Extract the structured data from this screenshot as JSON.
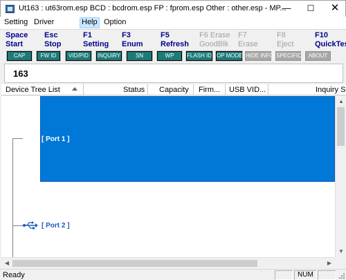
{
  "window": {
    "title": "Ut163 : ut63rom.esp BCD : bcdrom.esp FP : fprom.esp Other : other.esp - MP...",
    "minimize": "—",
    "maximize": "☐",
    "close": "✕"
  },
  "menu": {
    "setting": "Setting",
    "driver": "Driver",
    "help": "Help",
    "option": "Option"
  },
  "function_keys": [
    {
      "key": "Space",
      "label": "Start",
      "enabled": true
    },
    {
      "key": "Esc",
      "label": "Stop",
      "enabled": true
    },
    {
      "key": "F1",
      "label": "Setting",
      "enabled": true
    },
    {
      "key": "F3",
      "label": "Enum",
      "enabled": true
    },
    {
      "key": "F5",
      "label": "Refresh",
      "enabled": true
    },
    {
      "key": "F6 Erase",
      "label": "GoodBlk",
      "enabled": false
    },
    {
      "key": "F7",
      "label": "Erase",
      "enabled": false
    },
    {
      "key": "F8",
      "label": "Eject",
      "enabled": false
    },
    {
      "key": "F10",
      "label": "QuickTest",
      "enabled": true
    }
  ],
  "mode_buttons": [
    {
      "label": "CAP",
      "enabled": true
    },
    {
      "label": "FW ID",
      "enabled": true
    },
    {
      "label": "VID/PID",
      "enabled": true
    },
    {
      "label": "INQUIRY",
      "enabled": true
    },
    {
      "label": "SN",
      "enabled": true
    },
    {
      "label": "WP",
      "enabled": true
    },
    {
      "label": "FLASH ID",
      "enabled": true
    },
    {
      "label": "OP MODE",
      "enabled": true
    },
    {
      "label": "HIDE INFO",
      "enabled": false
    },
    {
      "label": "SPECIFIC",
      "enabled": false
    },
    {
      "label": "ABOUT",
      "enabled": false
    }
  ],
  "display": {
    "value": "163"
  },
  "columns": {
    "device_tree": "Device Tree List",
    "status": "Status",
    "capacity": "Capacity",
    "firmware": "Firm...",
    "usb_vid": "USB VID...",
    "inquiry": "Inquiry S"
  },
  "ports": [
    {
      "label": "[ Port  1 ]",
      "selected": true
    },
    {
      "label": "[ Port  2 ]",
      "selected": false
    }
  ],
  "status": {
    "text": "Ready",
    "num": "NUM"
  },
  "colors": {
    "selection": "#0078d7",
    "button_teal": "#1e7a78",
    "fn_key_blue": "#00008b",
    "usb_icon": "#1e5bb8"
  }
}
